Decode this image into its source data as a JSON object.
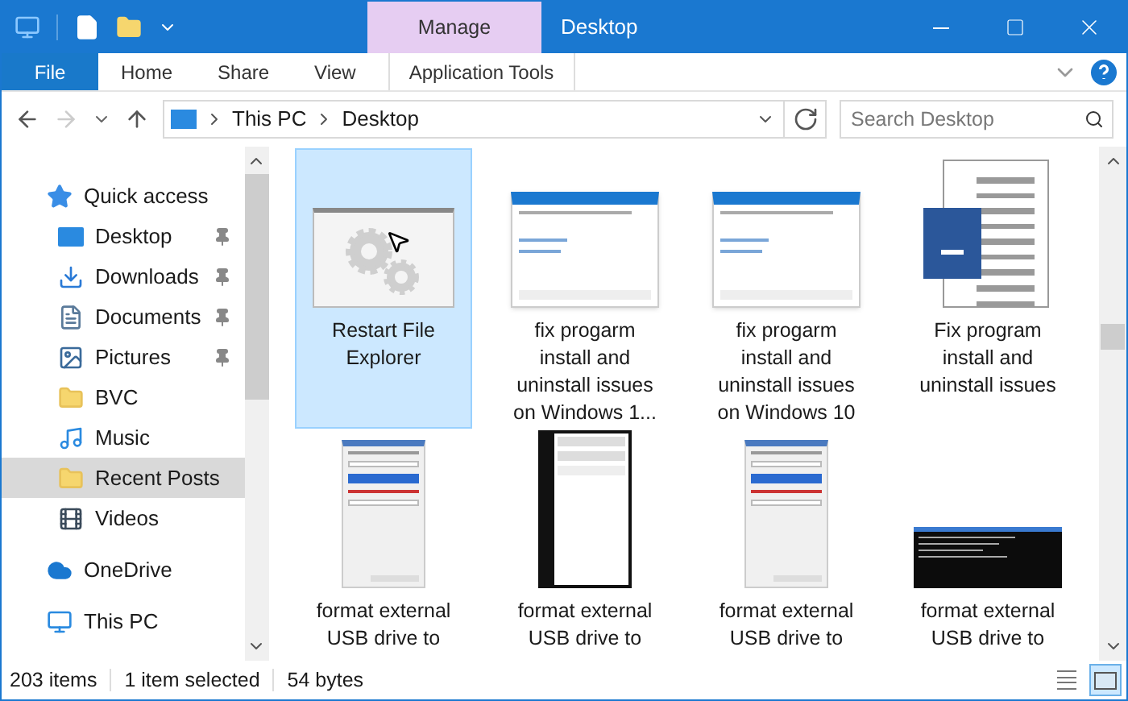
{
  "window": {
    "title": "Desktop",
    "context_tab": "Manage"
  },
  "ribbon_tabs": [
    {
      "label": "File",
      "kind": "file",
      "selected": false
    },
    {
      "label": "Home",
      "kind": "tab",
      "selected": false
    },
    {
      "label": "Share",
      "kind": "tab",
      "selected": false
    },
    {
      "label": "View",
      "kind": "tab",
      "selected": false
    },
    {
      "label": "Application Tools",
      "kind": "context",
      "selected": false
    }
  ],
  "address": {
    "path": [
      "This PC",
      "Desktop"
    ],
    "forward_disabled": true
  },
  "search": {
    "placeholder": "Search Desktop"
  },
  "sidebar": {
    "items": [
      {
        "label": "Quick access",
        "kind": "star",
        "selected": false,
        "children": [
          {
            "label": "Desktop",
            "kind": "desktop",
            "pinned": true,
            "selected": false
          },
          {
            "label": "Downloads",
            "kind": "download",
            "pinned": true,
            "selected": false
          },
          {
            "label": "Documents",
            "kind": "documents",
            "pinned": true,
            "selected": false
          },
          {
            "label": "Pictures",
            "kind": "pictures",
            "pinned": true,
            "selected": false
          },
          {
            "label": "BVC",
            "kind": "folder",
            "pinned": false,
            "selected": false
          },
          {
            "label": "Music",
            "kind": "music",
            "pinned": false,
            "selected": false
          },
          {
            "label": "Recent Posts",
            "kind": "folder",
            "pinned": false,
            "selected": true
          },
          {
            "label": "Videos",
            "kind": "videos",
            "pinned": false,
            "selected": false
          }
        ]
      },
      {
        "label": "OneDrive",
        "kind": "cloud",
        "selected": false
      },
      {
        "label": "This PC",
        "kind": "pc",
        "selected": false
      }
    ]
  },
  "files": [
    {
      "label": "Restart File Explorer",
      "kind": "app",
      "selected": true
    },
    {
      "label": "fix progarm install and uninstall issues on Windows 1...",
      "kind": "dialog",
      "selected": false
    },
    {
      "label": "fix progarm install and uninstall issues on Windows 10",
      "kind": "dialog",
      "selected": false
    },
    {
      "label": "Fix program install and uninstall issues",
      "kind": "word",
      "selected": false
    },
    {
      "label": "format external USB drive to",
      "kind": "form",
      "selected": false
    },
    {
      "label": "format external USB drive to",
      "kind": "settings",
      "selected": false
    },
    {
      "label": "format external USB drive to",
      "kind": "form",
      "selected": false
    },
    {
      "label": "format external USB drive to",
      "kind": "console",
      "selected": false
    }
  ],
  "status_bar": {
    "items": [
      "203 items",
      "1 item selected",
      "54 bytes"
    ],
    "views": [
      {
        "kind": "details",
        "selected": false
      },
      {
        "kind": "large",
        "selected": true
      }
    ]
  }
}
